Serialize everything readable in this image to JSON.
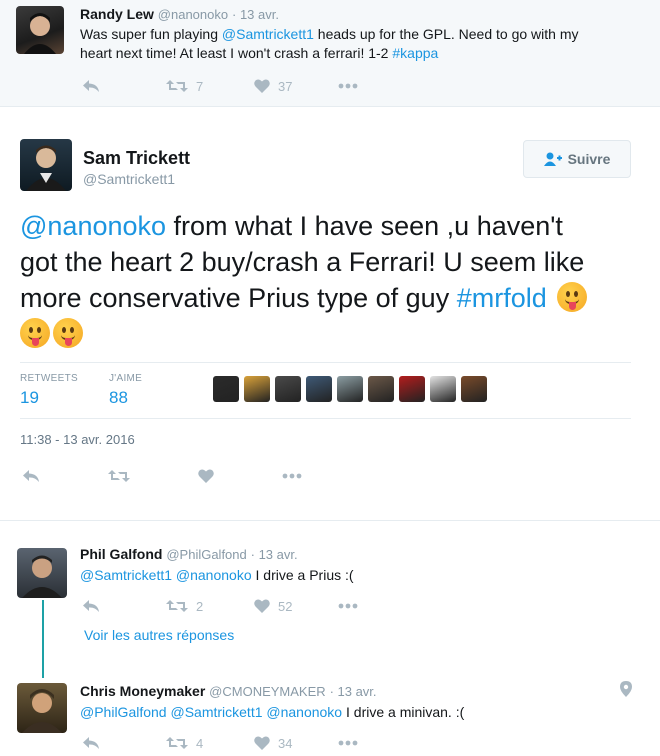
{
  "context_tweet": {
    "name": "Randy Lew",
    "handle": "@nanonoko",
    "date": "· 13 avr.",
    "text_a": "Was super fun playing ",
    "mention": "@Samtrickett1",
    "text_b": " heads up for the GPL. Need to go with my",
    "text_c": "heart next time! At least I won't crash a ferrari! 1-2 ",
    "hashtag": "#kappa",
    "retweets": "7",
    "likes": "37"
  },
  "main_tweet": {
    "name": "Sam Trickett",
    "handle": "@Samtrickett1",
    "follow_label": "Suivre",
    "mention": "@nanonoko",
    "text_a": " from what I have seen ,u haven't",
    "text_b": "got the heart 2 buy/crash a Ferrari! U seem like",
    "text_c": "more conservative Prius type of guy ",
    "hashtag": "#mrfold",
    "retweets_label": "RETWEETS",
    "retweets": "19",
    "likes_label": "J'AIME",
    "likes": "88",
    "timestamp": "11:38 - 13 avr. 2016"
  },
  "likers": [
    {
      "name": "liker-1",
      "color": "#2b2b2b"
    },
    {
      "name": "liker-2",
      "color": "#d9a23a"
    },
    {
      "name": "liker-3",
      "color": "#4a4a4a"
    },
    {
      "name": "liker-4",
      "color": "#3f5a77"
    },
    {
      "name": "liker-5",
      "color": "#8c9ea3"
    },
    {
      "name": "liker-6",
      "color": "#6b5848"
    },
    {
      "name": "liker-7",
      "color": "#b31d1d"
    },
    {
      "name": "liker-8",
      "color": "#e4e4e4"
    },
    {
      "name": "liker-9",
      "color": "#7a4b2a"
    }
  ],
  "replies": [
    {
      "name": "Phil Galfond",
      "handle": "@PhilGalfond",
      "date": "· 13 avr.",
      "mentions": "@Samtrickett1 @nanonoko",
      "text": " I drive a Prius :(",
      "retweets": "2",
      "likes": "52"
    },
    {
      "name": "Chris Moneymaker",
      "handle": "@CMONEYMAKER",
      "date": "· 13 avr.",
      "mentions": "@PhilGalfond @Samtrickett1 @nanonoko",
      "text": " I drive a minivan. :(",
      "retweets": "4",
      "likes": "34"
    }
  ],
  "more_replies_label": "Voir les autres réponses",
  "colors": {
    "accent": "#1b95e0",
    "muted": "#8899a6",
    "icon": "#aab8c2",
    "thread": "#1da1a6"
  }
}
